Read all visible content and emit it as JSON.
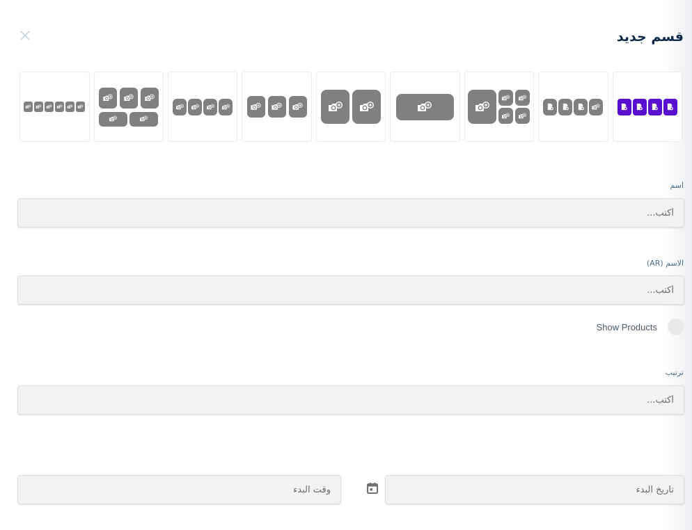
{
  "header": {
    "title": "قسم جديد",
    "close_icon": "close-icon"
  },
  "layouts": {
    "selected_index": 0,
    "selected_color": "#5a0fd0",
    "tile_color": "#808080",
    "options": [
      {
        "name": "four-product-icons",
        "selected": true
      },
      {
        "name": "one-camera-three-products",
        "selected": false
      },
      {
        "name": "one-large-four-small",
        "selected": false
      },
      {
        "name": "single-wide",
        "selected": false
      },
      {
        "name": "two-large",
        "selected": false
      },
      {
        "name": "three-medium",
        "selected": false
      },
      {
        "name": "four-small",
        "selected": false
      },
      {
        "name": "three-top-two-bottom",
        "selected": false
      },
      {
        "name": "six-tiny",
        "selected": false
      }
    ]
  },
  "form": {
    "name": {
      "label": "اسم",
      "placeholder": "أكتب...",
      "value": ""
    },
    "name_ar": {
      "label": "الاسم (AR)",
      "placeholder": "أكتب...",
      "value": ""
    },
    "show_products": {
      "label": "Show Products",
      "enabled": false
    },
    "order": {
      "label": "ترتيب",
      "placeholder": "أكتب...",
      "value": ""
    },
    "start_date": {
      "placeholder": "تاريخ البدء",
      "value": ""
    },
    "start_time": {
      "placeholder": "وقت البدء",
      "value": ""
    },
    "calendar_icon": "calendar-icon"
  }
}
